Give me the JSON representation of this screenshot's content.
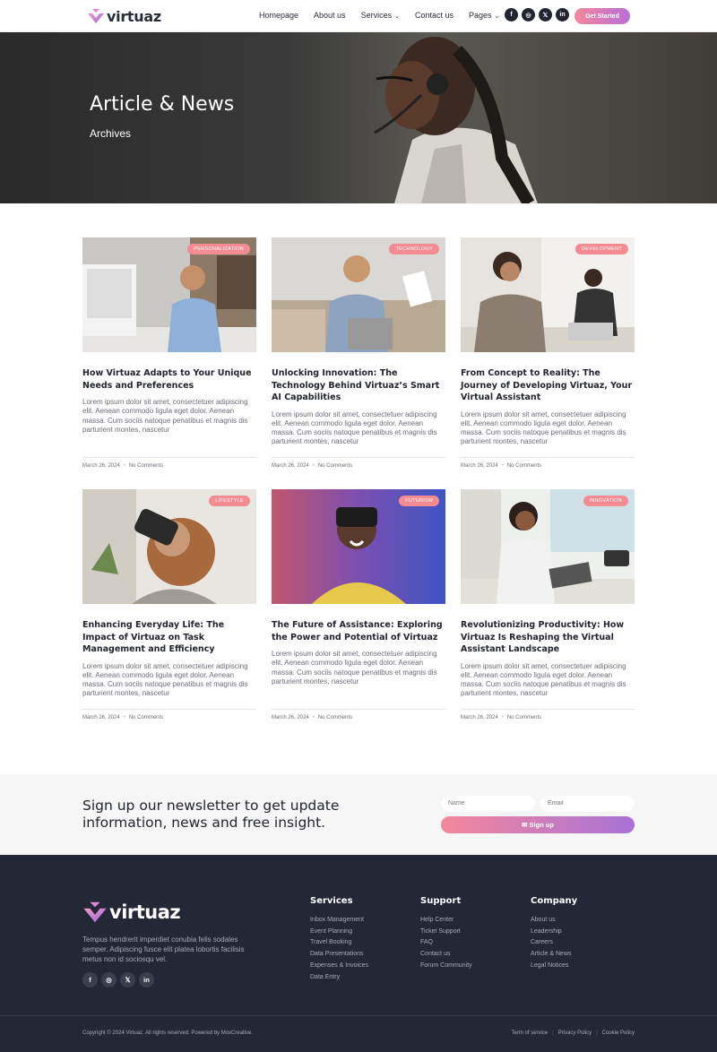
{
  "brand": {
    "name": "virtuaz",
    "accent_pink": "#f5879b",
    "accent_purple": "#a872d8"
  },
  "nav": {
    "items": [
      {
        "label": "Homepage",
        "dropdown": false
      },
      {
        "label": "About us",
        "dropdown": false
      },
      {
        "label": "Services",
        "dropdown": true
      },
      {
        "label": "Contact us",
        "dropdown": false
      },
      {
        "label": "Pages",
        "dropdown": true
      }
    ],
    "socials": [
      "f",
      "◎",
      "𝕏",
      "in"
    ],
    "cta": "Get Started"
  },
  "hero": {
    "title": "Article & News",
    "subtitle": "Archives"
  },
  "posts": [
    {
      "tag": "PERSONALIZATION",
      "title": "How Virtuaz Adapts to Your Unique Needs and Preferences",
      "excerpt": "Lorem ipsum dolor sit amet, consectetuer adipiscing elit. Aenean commodo ligula eget dolor. Aenean massa. Cum sociis natoque penatibus et magnis dis parturient montes, nascetur",
      "date": "March 26, 2024",
      "comments": "No Comments"
    },
    {
      "tag": "TECHNOLOGY",
      "title": "Unlocking Innovation: The Technology Behind Virtuaz’s Smart AI Capabilities",
      "excerpt": "Lorem ipsum dolor sit amet, consectetuer adipiscing elit. Aenean commodo ligula eget dolor. Aenean massa. Cum sociis natoque penatibus et magnis dis parturient montes, nascetur",
      "date": "March 26, 2024",
      "comments": "No Comments"
    },
    {
      "tag": "DEVELOPMENT",
      "title": "From Concept to Reality: The Journey of Developing Virtuaz, Your Virtual Assistant",
      "excerpt": "Lorem ipsum dolor sit amet, consectetuer adipiscing elit. Aenean commodo ligula eget dolor. Aenean massa. Cum sociis natoque penatibus et magnis dis parturient montes, nascetur",
      "date": "March 26, 2024",
      "comments": "No Comments"
    },
    {
      "tag": "LIFESTYLE",
      "title": "Enhancing Everyday Life: The Impact of Virtuaz on Task Management and Efficiency",
      "excerpt": "Lorem ipsum dolor sit amet, consectetuer adipiscing elit. Aenean commodo ligula eget dolor. Aenean massa. Cum sociis natoque penatibus et magnis dis parturient montes, nascetur",
      "date": "March 26, 2024",
      "comments": "No Comments"
    },
    {
      "tag": "FUTURISM",
      "title": "The Future of Assistance: Exploring the Power and Potential of Virtuaz",
      "excerpt": "Lorem ipsum dolor sit amet, consectetuer adipiscing elit. Aenean commodo ligula eget dolor. Aenean massa. Cum sociis natoque penatibus et magnis dis parturient montes, nascetur",
      "date": "March 26, 2024",
      "comments": "No Comments"
    },
    {
      "tag": "INNOVATION",
      "title": "Revolutionizing Productivity: How Virtuaz Is Reshaping the Virtual Assistant Landscape",
      "excerpt": "Lorem ipsum dolor sit amet, consectetuer adipiscing elit. Aenean commodo ligula eget dolor. Aenean massa. Cum sociis natoque penatibus et magnis dis parturient montes, nascetur",
      "date": "March 26, 2024",
      "comments": "No Comments"
    }
  ],
  "newsletter": {
    "heading": "Sign up our newsletter to get update information, news and free insight.",
    "name_placeholder": "Name",
    "email_placeholder": "Email",
    "button": "✉ Sign up"
  },
  "footer": {
    "description": "Tempus hendrerit imperdiet conubia felis sodales semper. Adipiscing fusce elit platea lobortis facilisis metus non id sociosqu vel.",
    "socials": [
      "f",
      "◎",
      "𝕏",
      "in"
    ],
    "columns": [
      {
        "title": "Services",
        "links": [
          "Inbox Management",
          "Event Planning",
          "Travel Booking",
          "Data Presentations",
          "Expenses & Invoices",
          "Data Entry"
        ]
      },
      {
        "title": "Support",
        "links": [
          "Help Center",
          "Ticket Support",
          "FAQ",
          "Contact us",
          "Forum Community"
        ]
      },
      {
        "title": "Company",
        "links": [
          "About us",
          "Leadership",
          "Careers",
          "Article & News",
          "Legal Notices"
        ]
      }
    ],
    "copyright": "Copyright © 2024 Virtuaz. All rights reserved. Powered by MoxCreative.",
    "legal": [
      "Term of service",
      "Privacy Policy",
      "Cookie Policy"
    ]
  }
}
